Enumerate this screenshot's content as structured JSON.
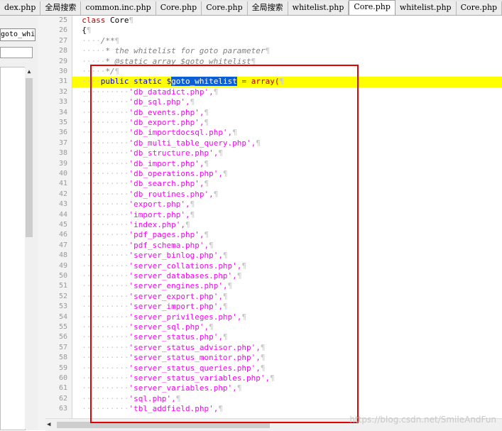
{
  "tabs": [
    "dex.php",
    "全局搜索",
    "common.inc.php",
    "Core.php",
    "Core.php",
    "全局搜索",
    "whitelist.php",
    "Core.php",
    "whitelist.php",
    "Core.php",
    "Core.php"
  ],
  "active_tab_index": 7,
  "left_panel": {
    "field_value": "goto_whitel"
  },
  "code": {
    "line_numbers": [
      "25",
      "26",
      "27",
      "28",
      "29",
      "30",
      "31",
      "32",
      "33",
      "34",
      "35",
      "36",
      "37",
      "38",
      "39",
      "40",
      "41",
      "42",
      "43",
      "44",
      "45",
      "46",
      "47",
      "48",
      "49",
      "50",
      "51",
      "52",
      "53",
      "54",
      "55",
      "56",
      "57",
      "58",
      "59",
      "60",
      "61",
      "62",
      "63"
    ],
    "class_kw": "class",
    "class_name": "Core",
    "open_brace": "{",
    "doc_open": "/**",
    "doc_line1": "* the whitelist for goto parameter",
    "doc_line2": "* @static array $goto_whitelist",
    "doc_close": "*/",
    "decl_public": "public",
    "decl_static": "static",
    "decl_dollar": "$",
    "decl_var": "goto_whitelist",
    "decl_eq": "=",
    "decl_array": "array(",
    "items": [
      "'db_datadict.php',",
      "'db_sql.php',",
      "'db_events.php',",
      "'db_export.php',",
      "'db_importdocsql.php',",
      "'db_multi_table_query.php',",
      "'db_structure.php',",
      "'db_import.php',",
      "'db_operations.php',",
      "'db_search.php',",
      "'db_routines.php',",
      "'export.php',",
      "'import.php',",
      "'index.php',",
      "'pdf_pages.php',",
      "'pdf_schema.php',",
      "'server_binlog.php',",
      "'server_collations.php',",
      "'server_databases.php',",
      "'server_engines.php',",
      "'server_export.php',",
      "'server_import.php',",
      "'server_privileges.php',",
      "'server_sql.php',",
      "'server_status.php',",
      "'server_status_advisor.php',",
      "'server_status_monitor.php',",
      "'server_status_queries.php',",
      "'server_status_variables.php',",
      "'server_variables.php',",
      "'sql.php',",
      "'tbl_addfield.php',"
    ]
  },
  "watermark": "https://blog.csdn.net/SmileAndFun",
  "colors": {
    "highlight": "#ffff00",
    "selection": "#0a5fd6",
    "annotation_box": "#e60000"
  }
}
